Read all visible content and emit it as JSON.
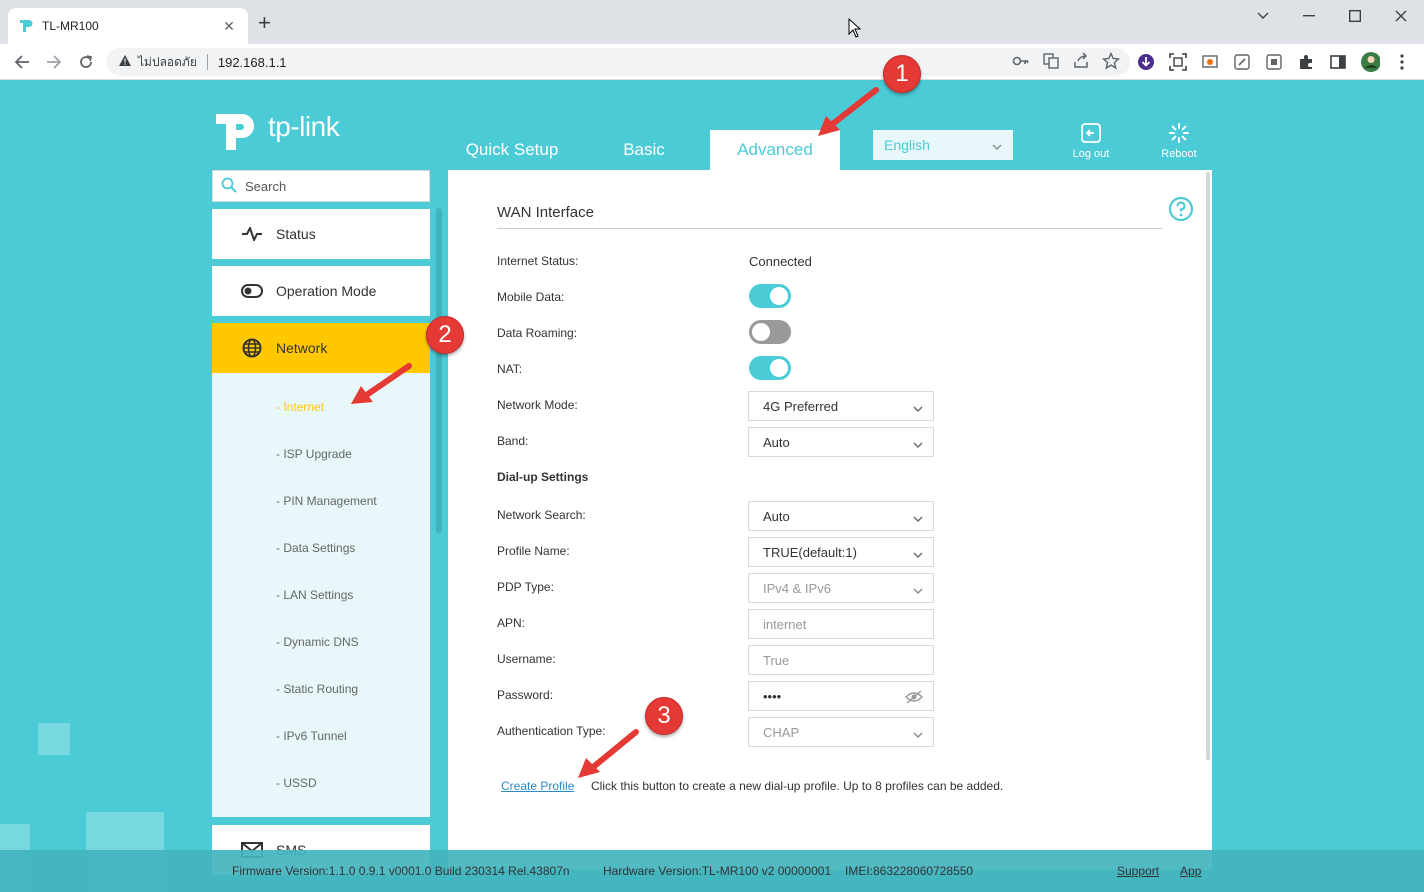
{
  "browser": {
    "tab_title": "TL-MR100",
    "new_tab": "+",
    "insecure_label": "ไม่ปลอดภัย",
    "url": "192.168.1.1"
  },
  "header": {
    "logo_text": "tp-link",
    "tabs": [
      {
        "label": "Quick Setup"
      },
      {
        "label": "Basic"
      },
      {
        "label": "Advanced"
      }
    ],
    "language": "English",
    "logout_label": "Log out",
    "reboot_label": "Reboot"
  },
  "sidebar": {
    "search_placeholder": "Search",
    "items": [
      {
        "label": "Status"
      },
      {
        "label": "Operation Mode"
      },
      {
        "label": "Network"
      },
      {
        "label": "SMS"
      }
    ],
    "sub_items": [
      {
        "label": "- Internet"
      },
      {
        "label": "- ISP Upgrade"
      },
      {
        "label": "- PIN Management"
      },
      {
        "label": "- Data Settings"
      },
      {
        "label": "- LAN Settings"
      },
      {
        "label": "- Dynamic DNS"
      },
      {
        "label": "- Static Routing"
      },
      {
        "label": "- IPv6 Tunnel"
      },
      {
        "label": "- USSD"
      }
    ]
  },
  "content": {
    "section_title": "WAN Interface",
    "internet_status_label": "Internet Status:",
    "internet_status_value": "Connected",
    "mobile_data_label": "Mobile Data:",
    "mobile_data_on": true,
    "data_roaming_label": "Data Roaming:",
    "data_roaming_on": false,
    "nat_label": "NAT:",
    "nat_on": true,
    "network_mode_label": "Network Mode:",
    "network_mode_value": "4G Preferred",
    "band_label": "Band:",
    "band_value": "Auto",
    "dialup_heading": "Dial-up Settings",
    "network_search_label": "Network Search:",
    "network_search_value": "Auto",
    "profile_name_label": "Profile Name:",
    "profile_name_value": "TRUE(default:1)",
    "pdp_type_label": "PDP Type:",
    "pdp_type_value": "IPv4 & IPv6",
    "apn_label": "APN:",
    "apn_value": "internet",
    "username_label": "Username:",
    "username_value": "True",
    "password_label": "Password:",
    "password_value": "••••",
    "auth_type_label": "Authentication Type:",
    "auth_type_value": "CHAP",
    "create_profile_label": "Create Profile",
    "create_profile_desc": "Click this button to create a new dial-up profile. Up to 8 profiles can be added."
  },
  "footer": {
    "firmware": "Firmware Version:1.1.0 0.9.1 v0001.0 Build 230314 Rel.43807n",
    "hardware": "Hardware Version:TL-MR100 v2 00000001",
    "imei": "IMEI:863228060728550",
    "support": "Support",
    "app": "App"
  },
  "annotations": {
    "badge_1": "1",
    "badge_2": "2",
    "badge_3": "3"
  },
  "colors": {
    "brand": "#4acbd6",
    "active_menu": "#ffc800",
    "annotation": "#e53935"
  }
}
